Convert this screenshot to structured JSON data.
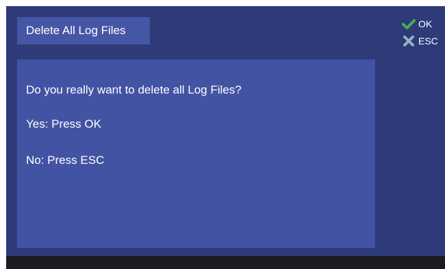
{
  "dialog": {
    "title": "Delete All Log Files",
    "question": "Do you really want to delete all Log Files?",
    "yes_instruction": "Yes: Press OK",
    "no_instruction": "No: Press ESC"
  },
  "keys": {
    "ok": {
      "label": "OK",
      "icon": "check-icon",
      "color": "#4caf50"
    },
    "esc": {
      "label": "ESC",
      "icon": "cross-icon",
      "color": "#8fb3bf"
    }
  },
  "colors": {
    "screen_background": "#2f3a79",
    "panel_background": "#4353a3",
    "title_background": "#4656a6",
    "bottom_bar": "#1b1b21",
    "text": "#ffffff"
  }
}
